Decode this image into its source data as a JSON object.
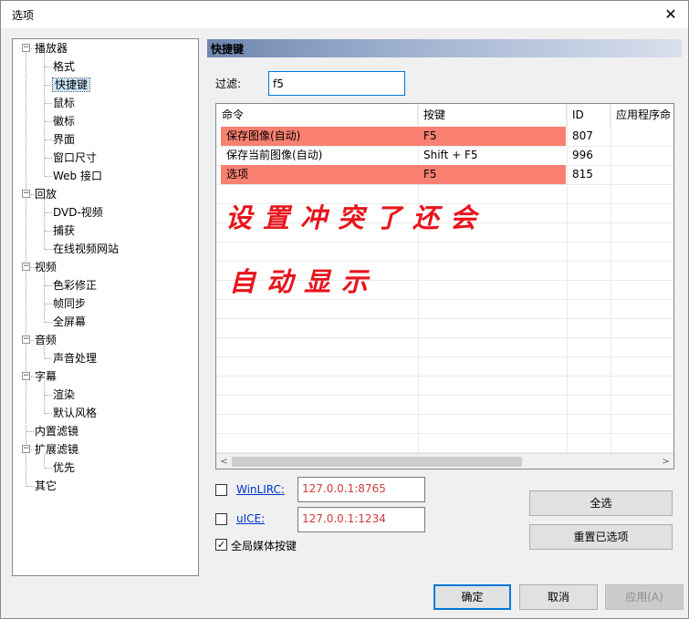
{
  "window": {
    "title": "选项",
    "close_glyph": "✕"
  },
  "tree": {
    "items": [
      {
        "label": "播放器",
        "level": 0,
        "expanded": true
      },
      {
        "label": "格式",
        "level": 1
      },
      {
        "label": "快捷键",
        "level": 1,
        "selected": true
      },
      {
        "label": "鼠标",
        "level": 1
      },
      {
        "label": "徽标",
        "level": 1
      },
      {
        "label": "界面",
        "level": 1
      },
      {
        "label": "窗口尺寸",
        "level": 1
      },
      {
        "label": "Web 接口",
        "level": 1
      },
      {
        "label": "回放",
        "level": 0,
        "expanded": true
      },
      {
        "label": "DVD-视频",
        "level": 1
      },
      {
        "label": "捕获",
        "level": 1
      },
      {
        "label": "在线视频网站",
        "level": 1
      },
      {
        "label": "视频",
        "level": 0,
        "expanded": true
      },
      {
        "label": "色彩修正",
        "level": 1
      },
      {
        "label": "帧同步",
        "level": 1
      },
      {
        "label": "全屏幕",
        "level": 1
      },
      {
        "label": "音频",
        "level": 0,
        "expanded": true
      },
      {
        "label": "声音处理",
        "level": 1
      },
      {
        "label": "字幕",
        "level": 0,
        "expanded": true
      },
      {
        "label": "渲染",
        "level": 1
      },
      {
        "label": "默认风格",
        "level": 1
      },
      {
        "label": "内置滤镜",
        "level": 0,
        "leaf": true
      },
      {
        "label": "扩展滤镜",
        "level": 0,
        "expanded": true
      },
      {
        "label": "优先",
        "level": 1
      },
      {
        "label": "其它",
        "level": 0,
        "leaf": true
      }
    ]
  },
  "panel": {
    "title": "快捷键"
  },
  "filter": {
    "label": "过滤:",
    "value": "f5"
  },
  "table": {
    "columns": [
      "命令",
      "按键",
      "ID",
      "应用程序命"
    ],
    "rows": [
      {
        "command": "保存图像(自动)",
        "key": "F5",
        "id": "807",
        "app": "",
        "conflict": true
      },
      {
        "command": "保存当前图像(自动)",
        "key": "Shift + F5",
        "id": "996",
        "app": "",
        "conflict": false
      },
      {
        "command": "选项",
        "key": "F5",
        "id": "815",
        "app": "",
        "conflict": true
      }
    ],
    "conflict_color": "#fa8072"
  },
  "annotation": {
    "line1": "设置冲突了还会",
    "line2": "自动显示",
    "color": "#e8141c"
  },
  "remote": {
    "winlirc": {
      "label": "WinLIRC:",
      "address": "127.0.0.1:8765",
      "checked": false
    },
    "uice": {
      "label": "uICE:",
      "address": "127.0.0.1:1234",
      "checked": false
    },
    "global_media": {
      "label": "全局媒体按键",
      "checked": true,
      "check_glyph": "✓"
    }
  },
  "actions": {
    "select_all": "全选",
    "reset_selected": "重置已选项"
  },
  "footer": {
    "ok": "确定",
    "cancel": "取消",
    "apply": "应用(A)"
  },
  "scroll_glyphs": {
    "left": "<",
    "right": ">"
  }
}
